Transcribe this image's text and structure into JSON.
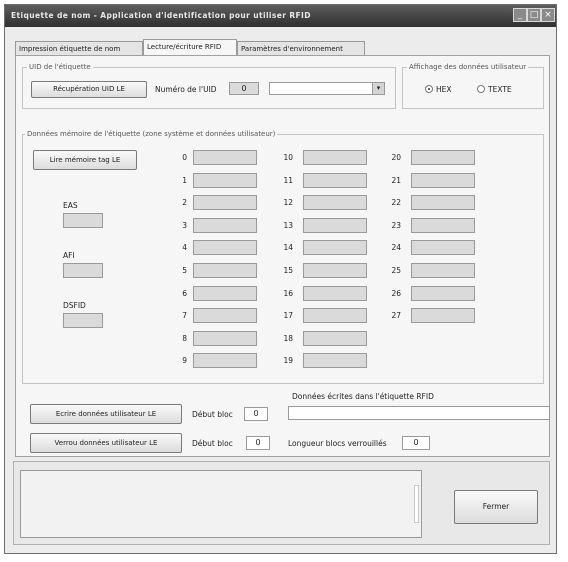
{
  "window": {
    "title": "Etiquette de nom - Application d'identification pour utiliser RFID"
  },
  "tabs": [
    {
      "label": "Impression étiquette de nom"
    },
    {
      "label": "Lecture/écriture RFID"
    },
    {
      "label": "Paramètres d'environnement"
    }
  ],
  "uid_group": {
    "legend": "UID de l'étiquette",
    "get_uid_button": "Récupération UID LE",
    "uid_number_label": "Numéro de l'UID",
    "uid_number_value": "0",
    "uid_select_value": ""
  },
  "display_group": {
    "legend": "Affichage des données utilisateur",
    "hex_label": "HEX",
    "text_label": "TEXTE",
    "selected": "HEX"
  },
  "memory_group": {
    "legend": "Données mémoire de l'étiquette (zone système et données utilisateur)",
    "read_button": "Lire mémoire tag LE",
    "eas_label": "EAS",
    "afi_label": "AFI",
    "dsfid_label": "DSFID",
    "blocks_col1": [
      "0",
      "1",
      "2",
      "3",
      "4",
      "5",
      "6",
      "7",
      "8",
      "9"
    ],
    "blocks_col2": [
      "10",
      "11",
      "12",
      "13",
      "14",
      "15",
      "16",
      "17",
      "18",
      "19"
    ],
    "blocks_col3": [
      "20",
      "21",
      "22",
      "23",
      "24",
      "25",
      "26",
      "27"
    ]
  },
  "write_section": {
    "write_button": "Ecrire données utilisateur LE",
    "write_start_label": "Début bloc",
    "write_start_value": "0",
    "written_data_label": "Données écrites dans l'étiquette RFID",
    "written_data_value": "",
    "lock_button": "Verrou données utilisateur LE",
    "lock_start_label": "Début bloc",
    "lock_start_value": "0",
    "lock_length_label": "Longueur blocs verrouillés",
    "lock_length_value": "0"
  },
  "footer": {
    "close_button": "Fermer"
  },
  "colors": {
    "titlebar": "#3d3d3d",
    "panel": "#f6f6f6",
    "field": "#dadada"
  }
}
